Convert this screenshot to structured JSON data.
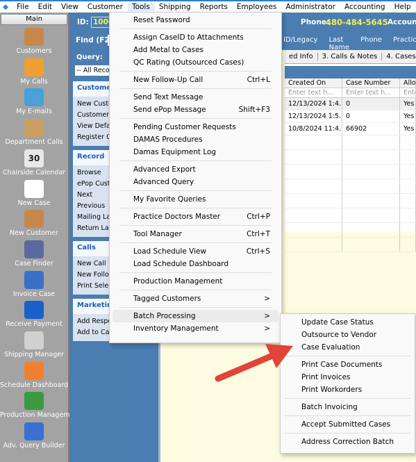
{
  "menubar": {
    "items": [
      "File",
      "Edit",
      "View",
      "Customer",
      "Tools",
      "Shipping",
      "Reports",
      "Employees",
      "Administrator",
      "Accounting",
      "Help"
    ],
    "open": "Tools"
  },
  "sidebar": {
    "header": "Main",
    "items": [
      {
        "label": "Customers",
        "icon": "address-book-icon"
      },
      {
        "label": "My Calls",
        "icon": "pencil-icon"
      },
      {
        "label": "My E-mails",
        "icon": "envelope-icon"
      },
      {
        "label": "Department Calls",
        "icon": "clipboard-icon"
      },
      {
        "label": "Chairside Calendar",
        "icon": "calendar-icon",
        "text": "30"
      },
      {
        "label": "New Case",
        "icon": "new-document-icon"
      },
      {
        "label": "New Customer",
        "icon": "new-customer-icon"
      },
      {
        "label": "Case Finder",
        "icon": "glasses-icon"
      },
      {
        "label": "Invoice Case",
        "icon": "invoice-icon"
      },
      {
        "label": "Receive Payment",
        "icon": "dollar-icon"
      },
      {
        "label": "Shipping Manager",
        "icon": "ship-icon"
      },
      {
        "label": "Schedule Dashboard",
        "icon": "pie-chart-icon"
      },
      {
        "label": "Production Management",
        "icon": "production-icon"
      },
      {
        "label": "Adv. Query Builder",
        "icon": "magnifier-icon"
      }
    ]
  },
  "topbar": {
    "id_label": "ID:",
    "id_value": "1000",
    "phone_label": "Phone:",
    "phone_value": "480-484-5645",
    "account_label": "Account#"
  },
  "findbar": {
    "label": "Find (F2)",
    "columns": [
      "ID/Legacy",
      "Last Name",
      "Phone",
      "Practice"
    ]
  },
  "leftpanel": {
    "query_label": "Query:",
    "query_value": "-- All Records",
    "sections": [
      {
        "title": "Customer",
        "items": [
          "New Customer",
          "Customer Search",
          "View Default",
          "Register Co"
        ]
      },
      {
        "title": "Record",
        "items": [
          "Browse",
          "ePop Customer",
          "Next",
          "Previous",
          "Mailing Labels",
          "Return Labels"
        ]
      },
      {
        "title": "Calls",
        "items": [
          "New Call",
          "New Follow",
          "Print Selected"
        ]
      },
      {
        "title": "Marketing",
        "items": [
          "Add Response",
          "Add to Campaign"
        ]
      }
    ]
  },
  "tabs": [
    "ed Info",
    "3. Calls & Notes",
    "4. Cases",
    "5. A"
  ],
  "grid": {
    "columns": [
      "Created On",
      "Case Number",
      "Allow"
    ],
    "filter_placeholder": "Enter text h...",
    "filter_short": "Ente",
    "rows": [
      [
        "12/13/2024 1:4...",
        "0",
        "Yes"
      ],
      [
        "12/13/2024 1:5...",
        "0",
        "Yes"
      ],
      [
        "10/8/2024 11:4...",
        "66902",
        "Yes"
      ]
    ]
  },
  "tools_menu": {
    "groups": [
      [
        {
          "label": "Reset Password"
        }
      ],
      [
        {
          "label": "Assign CaseID to Attachments"
        },
        {
          "label": "Add Metal to Cases"
        },
        {
          "label": "QC Rating (Outsourced Cases)"
        }
      ],
      [
        {
          "label": "New Follow-Up Call",
          "shortcut": "Ctrl+L"
        }
      ],
      [
        {
          "label": "Send Text Message"
        },
        {
          "label": "Send ePop Message",
          "shortcut": "Shift+F3"
        }
      ],
      [
        {
          "label": "Pending Customer Requests"
        },
        {
          "label": "DAMAS Procedures"
        },
        {
          "label": "Damas Equipment Log"
        }
      ],
      [
        {
          "label": "Advanced Export"
        },
        {
          "label": "Advanced Query"
        }
      ],
      [
        {
          "label": "My Favorite Queries"
        }
      ],
      [
        {
          "label": "Practice Doctors Master",
          "shortcut": "Ctrl+P"
        }
      ],
      [
        {
          "label": "Tool Manager",
          "shortcut": "Ctrl+T"
        }
      ],
      [
        {
          "label": "Load Schedule View",
          "shortcut": "Ctrl+S"
        },
        {
          "label": "Load Schedule Dashboard"
        }
      ],
      [
        {
          "label": "Production Management"
        }
      ],
      [
        {
          "label": "Tagged Customers",
          "submenu": ">"
        }
      ],
      [
        {
          "label": "Batch Processing",
          "submenu": ">",
          "highlighted": true
        },
        {
          "label": "Inventory Management",
          "submenu": ">"
        }
      ]
    ]
  },
  "batch_submenu": {
    "groups": [
      [
        "Update Case Status",
        "Outsource to Vendor",
        "Case Evaluation"
      ],
      [
        "Print Case Documents",
        "Print Invoices",
        "Print Workorders"
      ],
      [
        "Batch Invoicing"
      ],
      [
        "Accept Submitted Cases"
      ],
      [
        "Address Correction Batch"
      ]
    ]
  },
  "colors": {
    "header_blue": "#4b7db1",
    "phone_yellow": "#f5f04a",
    "arrow_red": "#e0443a",
    "content_bg": "#fdfbe0"
  }
}
